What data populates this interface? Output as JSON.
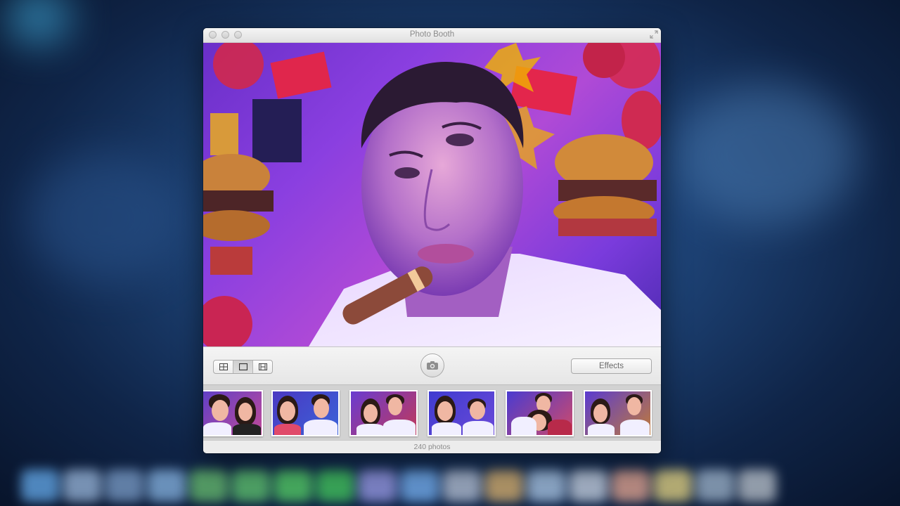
{
  "window": {
    "title": "Photo Booth"
  },
  "toolbar": {
    "view_modes": [
      {
        "name": "grid-view",
        "icon": "grid-icon",
        "selected": false
      },
      {
        "name": "single-view",
        "icon": "single-frame-icon",
        "selected": true
      },
      {
        "name": "filmstrip-view",
        "icon": "filmstrip-icon",
        "selected": false
      }
    ],
    "shutter_icon": "camera-icon",
    "effects_label": "Effects"
  },
  "filmstrip": {
    "thumbnail_count_visible": 6
  },
  "status": {
    "photo_count": "240 photos"
  },
  "colors": {
    "desktop_blue": "#1e4478",
    "preview_purple": "#8a3fe0",
    "chrome_gray": "#ececec"
  }
}
